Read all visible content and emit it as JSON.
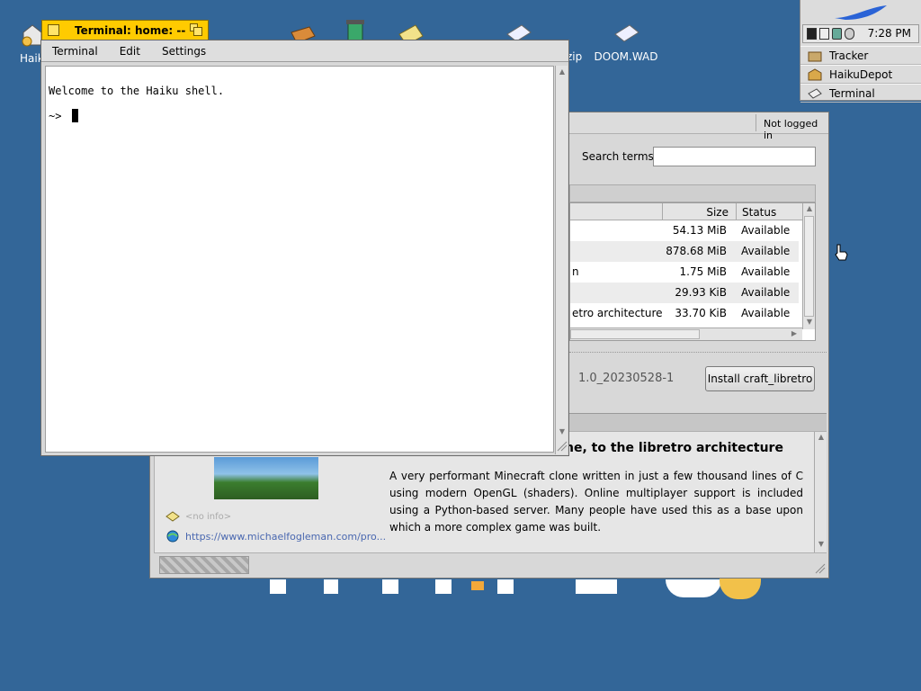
{
  "desktop": {
    "icons": [
      {
        "label": "Haik",
        "icon": "home-icon"
      },
      {
        "label": "",
        "icon": "book-icon"
      },
      {
        "label": "",
        "icon": "trash-icon"
      },
      {
        "label": "",
        "icon": "note-icon"
      },
      {
        "label": "zip",
        "icon": "archive-icon"
      },
      {
        "label": "DOOM.WAD",
        "icon": "wad-file-icon"
      }
    ]
  },
  "deskbar": {
    "clock": "7:28 PM",
    "items": [
      {
        "label": "Tracker",
        "icon": "tracker-icon"
      },
      {
        "label": "HaikuDepot",
        "icon": "haikudepot-icon"
      },
      {
        "label": "Terminal",
        "icon": "terminal-icon"
      }
    ]
  },
  "terminal": {
    "title": "Terminal: home: --",
    "menu": [
      "Terminal",
      "Edit",
      "Settings"
    ],
    "lines": [
      "Welcome to the Haiku shell.",
      "~> "
    ]
  },
  "depot": {
    "login_status": "Not logged in",
    "search_label": "Search terms:",
    "search_value": "",
    "columns": {
      "size": "Size",
      "status": "Status"
    },
    "rows": [
      {
        "name": "",
        "size": "54.13 MiB",
        "status": "Available"
      },
      {
        "name": "",
        "size": "878.68 MiB",
        "status": "Available"
      },
      {
        "name": "n",
        "size": "1.75 MiB",
        "status": "Available"
      },
      {
        "name": "",
        "size": "29.93 KiB",
        "status": "Available"
      },
      {
        "name": "etro architecture",
        "size": "33.70 KiB",
        "status": "Available"
      }
    ],
    "version": "1.0_20230528-1",
    "install_button": "Install craft_libretro",
    "package_title": "ne, to the libretro architecture",
    "description": "A very performant Minecraft clone written in just a few thousand lines of C using modern OpenGL (shaders). Online multiplayer support is included using a Python-based server. Many people have used this as a base upon which a more complex game was built.",
    "no_info": "<no info>",
    "url": "https://www.michaelfogleman.com/pro..."
  },
  "colors": {
    "desktop": "#336698",
    "tab": "#ffcb00",
    "window": "#d8d8d8",
    "link": "#4a68b0"
  }
}
